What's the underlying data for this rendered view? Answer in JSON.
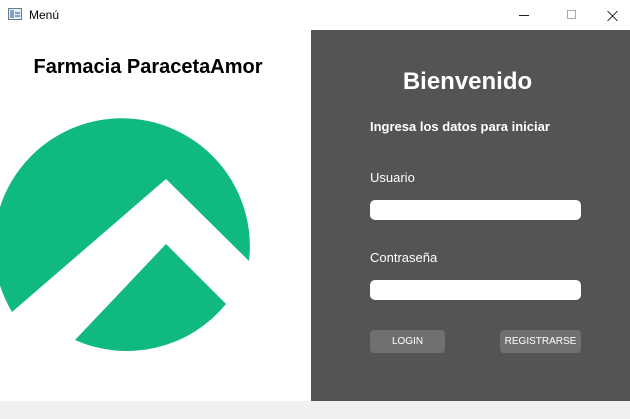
{
  "window": {
    "title": "Menú",
    "icon": "app-window-icon",
    "controls": [
      "minimize",
      "maximize",
      "close"
    ]
  },
  "brand": {
    "name": "Farmacia ParacetaAmor",
    "logo": "green-circle-mountain-logo",
    "logo_color": "#10b981"
  },
  "login": {
    "heading": "Bienvenido",
    "subtitle": "Ingresa los datos para iniciar",
    "username_label": "Usuario",
    "username_value": "",
    "password_label": "Contraseña",
    "password_value": "",
    "login_button": "LOGIN",
    "register_button": "REGISTRARSE",
    "panel_color": "#545454",
    "button_color": "#707070"
  }
}
